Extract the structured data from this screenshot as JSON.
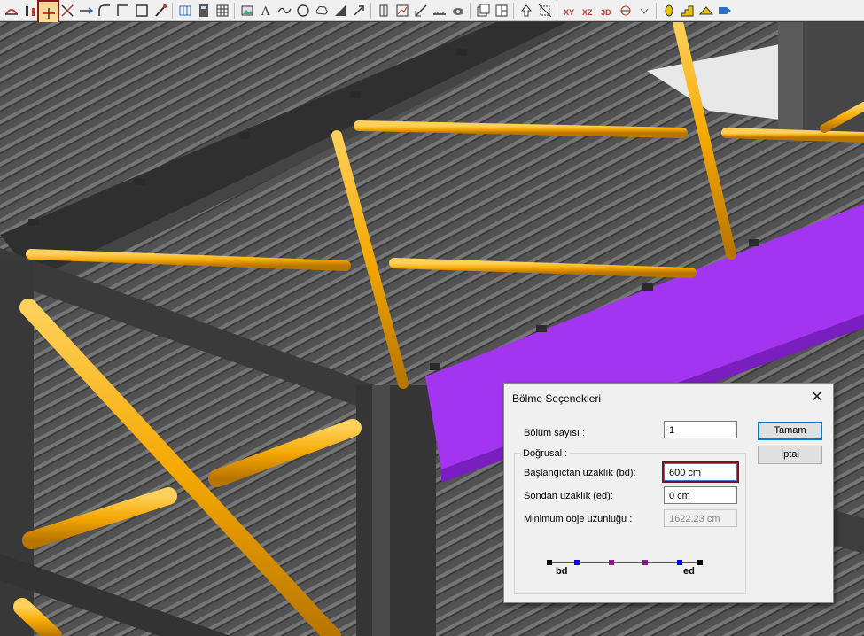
{
  "toolbar": {
    "icons": [
      "beam-tool-icon",
      "column-tool-icon",
      "divide-member-icon",
      "intersect-icon",
      "extend-icon",
      "fillet-icon",
      "corner-icon",
      "frame-tool-icon",
      "paint-icon",
      "grid-tool-icon",
      "calculator-icon",
      "table-icon",
      "image-icon",
      "text-icon",
      "spline-icon",
      "circle-icon",
      "cloud-icon",
      "hatch-icon",
      "arrow-icon",
      "column-section-icon",
      "chart-icon",
      "measure-icon",
      "ruler-icon",
      "camera-icon",
      "copy-window-icon",
      "split-window-icon",
      "move-up-icon",
      "resize-icon",
      "section-x-icon",
      "section-z-icon",
      "section-3d-icon",
      "section-view-icon",
      "expand-icon",
      "bolt-icon",
      "stair-icon",
      "roof-icon",
      "tag-icon"
    ]
  },
  "dialog": {
    "title": "Bölme Seçenekleri",
    "close_label": "✕",
    "bolum_sayisi_label": "Bölüm sayısı :",
    "bolum_sayisi_value": "1",
    "group_title": "Doğrusal :",
    "bd_label": "Başlangıçtan uzaklık (bd):",
    "bd_value": "600 cm",
    "ed_label": "Sondan uzaklık (ed):",
    "ed_value": "0 cm",
    "min_label": "Minimum obje uzunluğu :",
    "min_value": "1622.23 cm",
    "ok_label": "Tamam",
    "cancel_label": "İptal",
    "diagram_bd": "bd",
    "diagram_ed": "ed"
  },
  "colors": {
    "purlin": "#f5a800",
    "selected_beam": "#a335f0",
    "steel": "#3a3a3a"
  }
}
